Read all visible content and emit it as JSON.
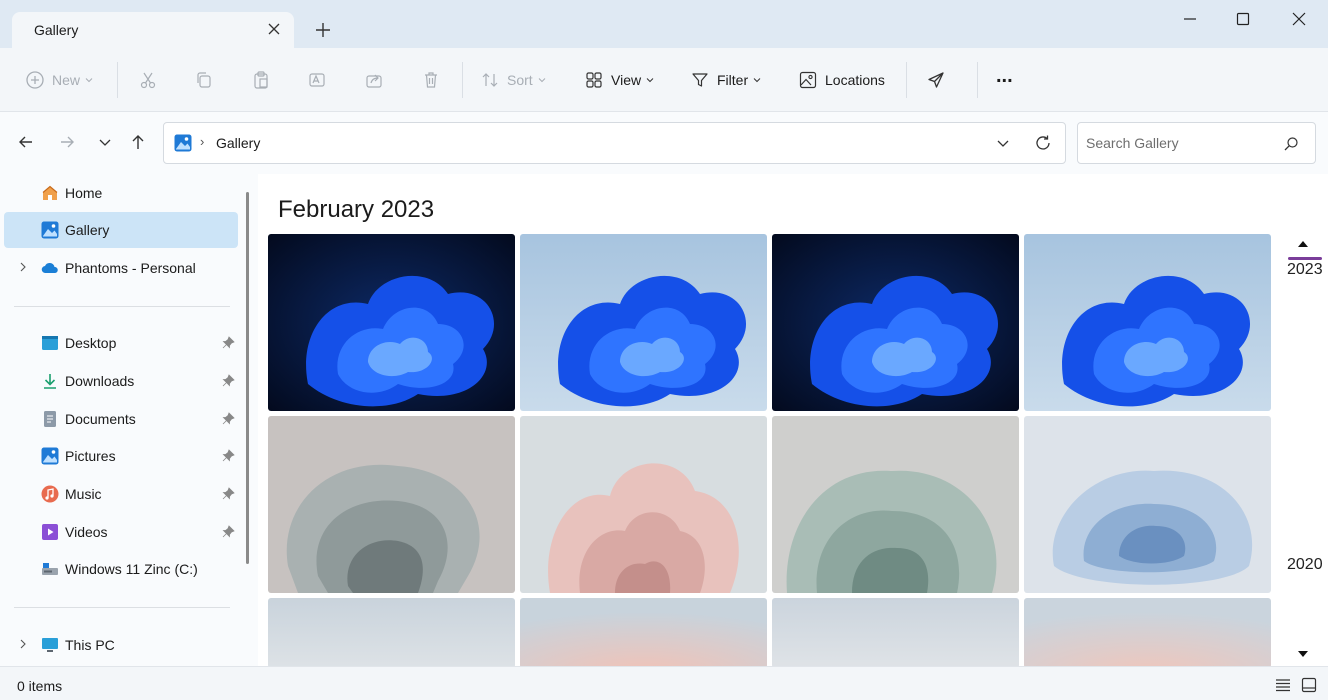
{
  "window": {
    "tab_title": "Gallery"
  },
  "toolbar": {
    "new_label": "New",
    "sort_label": "Sort",
    "view_label": "View",
    "filter_label": "Filter",
    "locations_label": "Locations",
    "more_label": "..."
  },
  "address": {
    "breadcrumb": "Gallery"
  },
  "search": {
    "placeholder": "Search Gallery"
  },
  "sidebar": {
    "items": [
      {
        "label": "Home"
      },
      {
        "label": "Gallery"
      },
      {
        "label": "Phantoms - Personal"
      },
      {
        "label": "Desktop"
      },
      {
        "label": "Downloads"
      },
      {
        "label": "Documents"
      },
      {
        "label": "Pictures"
      },
      {
        "label": "Music"
      },
      {
        "label": "Videos"
      },
      {
        "label": "Windows 11 Zinc (C:)"
      },
      {
        "label": "This PC"
      }
    ]
  },
  "gallery": {
    "group_title": "February 2023",
    "timeline": [
      "2023",
      "2020"
    ]
  },
  "status": {
    "item_count": "0 items"
  },
  "colors": {
    "accent_selected": "#cce4f7",
    "timeline_marker": "#7a3d9a",
    "titlebar": "#dfe9f3"
  }
}
